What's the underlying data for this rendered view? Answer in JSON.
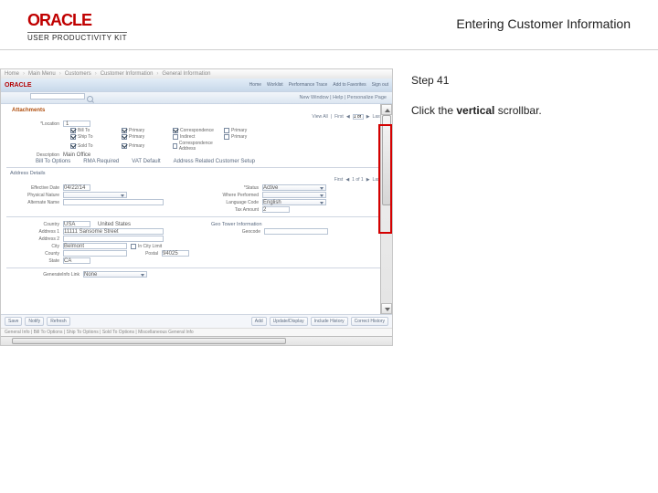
{
  "header": {
    "brand": "ORACLE",
    "brand_sub": "USER PRODUCTIVITY KIT",
    "title": "Entering Customer Information"
  },
  "step": {
    "label": "Step 41",
    "text_pre": "Click the ",
    "text_bold": "vertical",
    "text_post": " scrollbar."
  },
  "shot": {
    "breadcrumb": [
      "Home",
      "Main Menu",
      "Customers",
      "Customer Information",
      "General Information"
    ],
    "brand": "ORACLE",
    "tabs": [
      "Home",
      "Worklist",
      "Performance Trace",
      "Add to Favorites",
      "Sign out"
    ],
    "sub_right": "New Window | Help | Personalize Page",
    "attach_label": "Attachments",
    "attach_link": "View All",
    "pager": {
      "first": "First",
      "prev": "◀",
      "range": "1 of 1",
      "next": "▶",
      "last": "Last"
    },
    "loc_label": "*Location",
    "loc_value": "1",
    "desc_label": "Description",
    "desc_value": "Main Office",
    "eff_label": "Effective Date",
    "eff_value": "04/22/14",
    "checks": [
      {
        "label": "Bill To",
        "checked": true
      },
      {
        "label": "Primary",
        "checked": true
      },
      {
        "label": "Correspondence",
        "checked": true
      },
      {
        "label": "Primary",
        "checked": false
      },
      {
        "label": "Ship To",
        "checked": true
      },
      {
        "label": "Primary",
        "checked": true
      },
      {
        "label": "Indirect",
        "checked": false
      },
      {
        "label": "Primary",
        "checked": false
      },
      {
        "label": "Sold To",
        "checked": true
      },
      {
        "label": "Primary",
        "checked": true
      },
      {
        "label": "Correspondence Address",
        "checked": false
      },
      {
        "label": "",
        "checked": false
      }
    ],
    "links_row": [
      "Bill To Options",
      "RMA Required",
      "VAT Default",
      "Address Related Customer Setup"
    ],
    "addr_section": "Address Details",
    "eff_date_row_label": "Effective Date",
    "eff_date_row_value": "04/22/14",
    "status_label": "*Status",
    "status_value": "Active",
    "phys_label": "Physical Nature",
    "phys_ext_label": "Where Performed",
    "alt_name_label": "Alternate Name",
    "lang_label": "Language Code",
    "lang_value": "English",
    "tax_label": "Tax Amount",
    "tax_value": "2",
    "country_label": "Country",
    "country_value": "USA",
    "country_name": "United States",
    "addr1_label": "Address 1",
    "addr1_value": "11111 Sansome Street",
    "addr2_label": "Address 2",
    "city_label": "City",
    "city_value": "Belmont",
    "county_label": "County",
    "state_label": "State",
    "state_value": "CA",
    "postal_label": "Postal",
    "postal_value": "94025",
    "inCity_label": "In City Limit",
    "inCity_checked": false,
    "geo_section": "Geo Tower Information",
    "geo_label": "Geocode",
    "gis_label": "GenerateInfo Link",
    "gis_value": "None",
    "btns_left": [
      "Save",
      "Notify",
      "Refresh"
    ],
    "btns_right": [
      "Add",
      "Update/Display",
      "Include History",
      "Correct History"
    ],
    "status_bar": "General Info | Bill To Options | Ship To Options | Sold To Options | Miscellaneous General Info"
  }
}
